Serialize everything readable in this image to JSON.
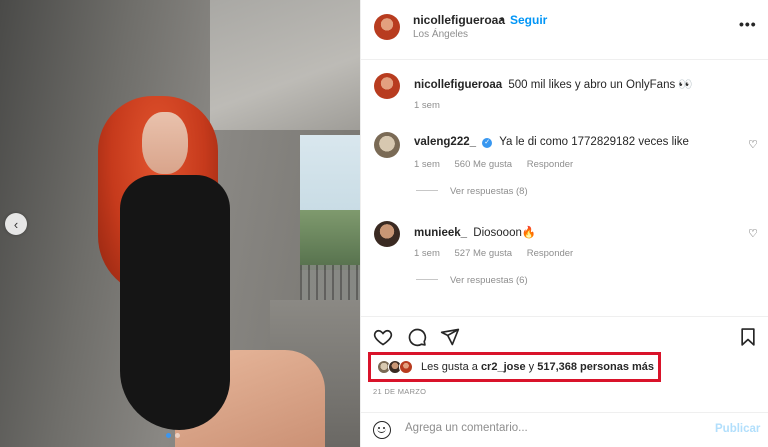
{
  "post": {
    "username": "nicollefigueroaa",
    "follow_label": "Seguir",
    "dot": "•",
    "location": "Los Ángeles",
    "more": "•••"
  },
  "caption": {
    "username": "nicollefigueroaa",
    "text": "500 mil likes y abro un OnlyFans 👀",
    "time": "1 sem"
  },
  "comments": [
    {
      "username": "valeng222_",
      "verified": true,
      "text": "Ya le di como 1772829182 veces like",
      "time": "1 sem",
      "likes": "560 Me gusta",
      "reply_label": "Responder",
      "view_replies": "Ver respuestas (8)"
    },
    {
      "username": "munieek_",
      "verified": false,
      "text": "Diosooon🔥",
      "time": "1 sem",
      "likes": "527 Me gusta",
      "reply_label": "Responder",
      "view_replies": "Ver respuestas (6)"
    }
  ],
  "likes_summary": {
    "prefix": "Les gusta a",
    "user": "cr2_jose",
    "middle": "y",
    "count": "517,368 personas más"
  },
  "date": "21 DE MARZO",
  "comment_input": {
    "placeholder": "Agrega un comentario...",
    "publish_label": "Publicar"
  },
  "carousel": {
    "prev_arrow": "‹",
    "slide_count": 2,
    "active_index": 0
  },
  "icons": {
    "like": "heart-icon",
    "comment": "comment-icon",
    "share": "paper-plane-icon",
    "save": "bookmark-icon",
    "emoji": "emoji-icon"
  },
  "colors": {
    "accent": "#0095f6",
    "highlight_border": "#d9132a",
    "muted_text": "#8e8e8e",
    "publish_disabled": "#b2dffc"
  }
}
